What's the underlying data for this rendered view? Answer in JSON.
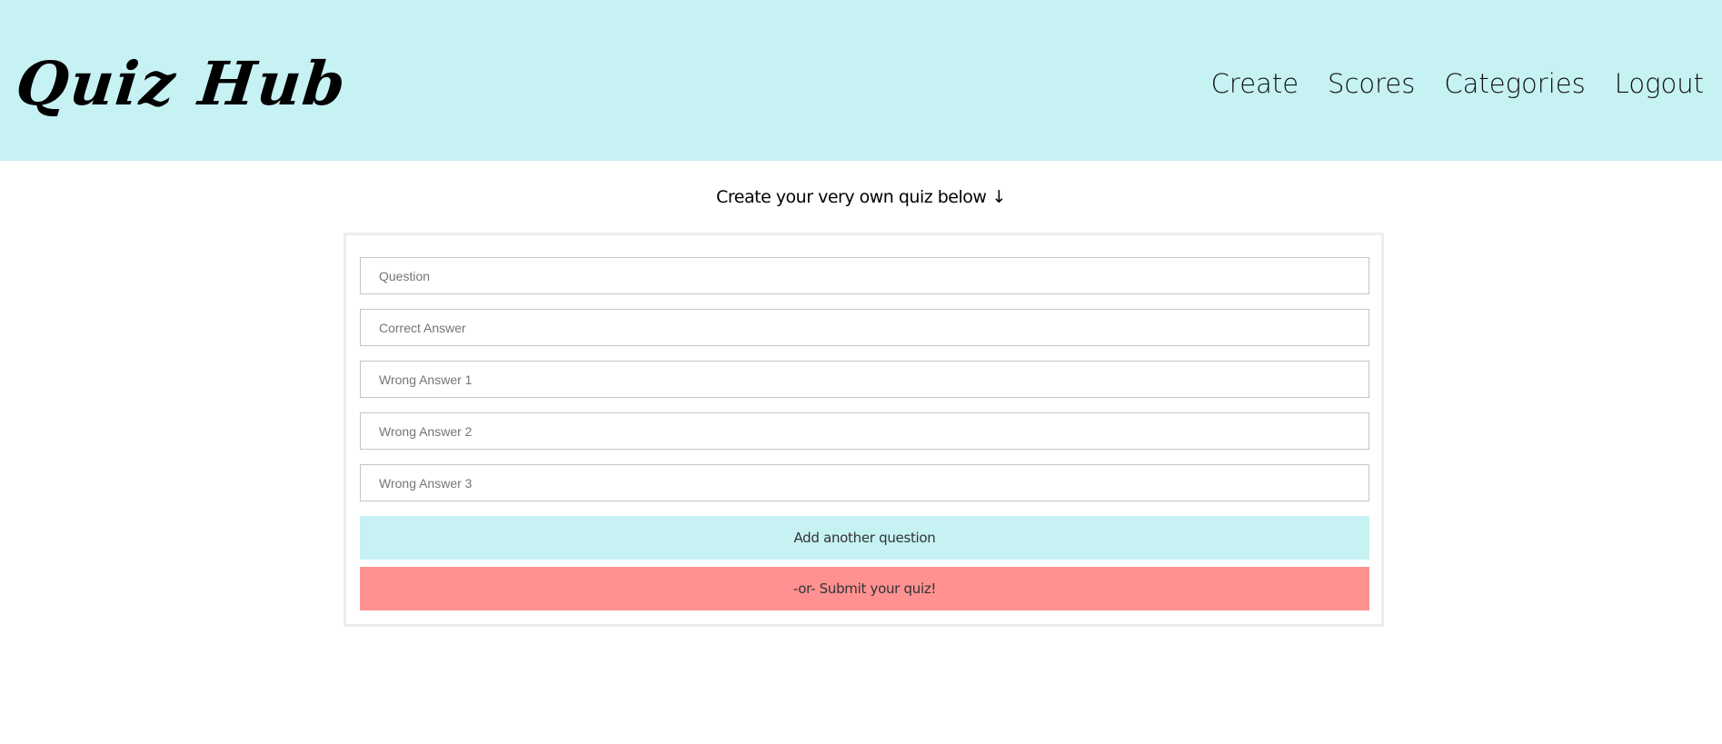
{
  "header": {
    "logo": "Quiz Hub",
    "nav": [
      "Create",
      "Scores",
      "Categories",
      "Logout"
    ]
  },
  "main": {
    "subtitle": "Create your very own quiz below",
    "subtitle_arrow": "↓",
    "fields": [
      {
        "placeholder": "Question",
        "value": ""
      },
      {
        "placeholder": "Correct Answer",
        "value": ""
      },
      {
        "placeholder": "Wrong Answer 1",
        "value": ""
      },
      {
        "placeholder": "Wrong Answer 2",
        "value": ""
      },
      {
        "placeholder": "Wrong Answer 3",
        "value": ""
      }
    ],
    "add_button": "Add another question",
    "submit_button": "-or- Submit your quiz!"
  },
  "colors": {
    "header_bg": "#c6f2f3",
    "add_button_bg": "#c6f2f3",
    "submit_button_bg": "#ff9191"
  }
}
